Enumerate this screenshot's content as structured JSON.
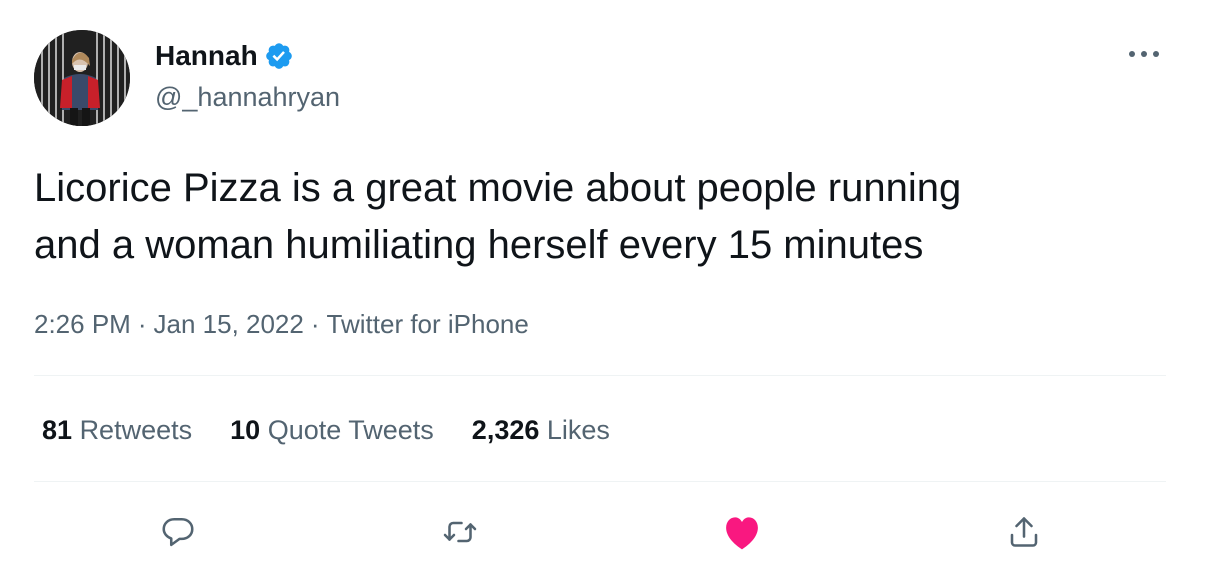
{
  "author": {
    "display_name": "Hannah",
    "handle": "@_hannahryan",
    "verified": true
  },
  "tweet": {
    "text": "Licorice Pizza is a great movie about people running\nand a woman humiliating herself every 15 minutes",
    "time": "2:26 PM",
    "date": "Jan 15, 2022",
    "source": "Twitter for iPhone",
    "separator": "·"
  },
  "stats": {
    "retweets": {
      "count": "81",
      "label": "Retweets"
    },
    "quote_tweets": {
      "count": "10",
      "label": "Quote Tweets"
    },
    "likes": {
      "count": "2,326",
      "label": "Likes"
    }
  },
  "actions": {
    "reply": "reply-icon",
    "retweet": "retweet-icon",
    "like": "heart-icon",
    "share": "share-icon",
    "liked": true
  },
  "colors": {
    "text": "#0f1419",
    "secondary": "#536471",
    "verified_blue": "#1d9bf0",
    "like_pink": "#f91880",
    "divider": "#eff3f4"
  }
}
